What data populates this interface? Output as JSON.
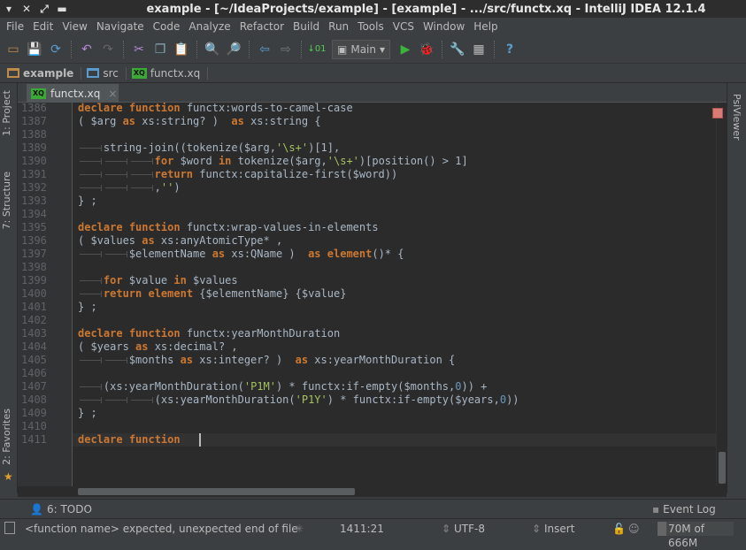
{
  "window": {
    "title": "example - [~/IdeaProjects/example] - [example] - .../src/functx.xq - IntelliJ IDEA 12.1.4"
  },
  "menu": [
    "File",
    "Edit",
    "View",
    "Navigate",
    "Code",
    "Analyze",
    "Refactor",
    "Build",
    "Run",
    "Tools",
    "VCS",
    "Window",
    "Help"
  ],
  "toolbar": {
    "run_config": "Main"
  },
  "breadcrumbs": [
    "example",
    "src",
    "functx.xq"
  ],
  "tabs": [
    {
      "label": "functx.xq",
      "close": "×"
    }
  ],
  "left_tools": {
    "project": "1: Project",
    "structure": "7: Structure",
    "favorites": "2: Favorites"
  },
  "right_tools": {
    "psiviewer": "PsiViewer"
  },
  "editor": {
    "first_line": 1386,
    "current_line": 1411,
    "lines": [
      [
        [
          "k",
          "declare"
        ],
        [
          "t",
          " "
        ],
        [
          "k",
          "function"
        ],
        [
          "t",
          " functx:words-to-camel-case"
        ]
      ],
      [
        [
          "t",
          "( $arg "
        ],
        [
          "k",
          "as"
        ],
        [
          "t",
          " xs:string? )  "
        ],
        [
          "k",
          "as"
        ],
        [
          "t",
          " xs:string {"
        ]
      ],
      [],
      [
        [
          "tab",
          ""
        ],
        [
          "t",
          "string-join((tokenize($arg,"
        ],
        [
          "s",
          "'\\s+'"
        ],
        [
          "t",
          ")[1],"
        ]
      ],
      [
        [
          "tab",
          ""
        ],
        [
          "tab",
          ""
        ],
        [
          "tab",
          ""
        ],
        [
          "k",
          "for"
        ],
        [
          "t",
          " $word "
        ],
        [
          "k",
          "in"
        ],
        [
          "t",
          " tokenize($arg,"
        ],
        [
          "s",
          "'\\s+'"
        ],
        [
          "t",
          ")[position() > 1]"
        ]
      ],
      [
        [
          "tab",
          ""
        ],
        [
          "tab",
          ""
        ],
        [
          "tab",
          ""
        ],
        [
          "k",
          "return"
        ],
        [
          "t",
          " functx:capitalize-first($word))"
        ]
      ],
      [
        [
          "tab",
          ""
        ],
        [
          "tab",
          ""
        ],
        [
          "tab",
          ""
        ],
        [
          "t",
          ","
        ],
        [
          "s",
          "''"
        ],
        [
          "t",
          ")"
        ]
      ],
      [
        [
          "t",
          "} ;"
        ]
      ],
      [],
      [
        [
          "k",
          "declare"
        ],
        [
          "t",
          " "
        ],
        [
          "k",
          "function"
        ],
        [
          "t",
          " functx:wrap-values-in-elements"
        ]
      ],
      [
        [
          "t",
          "( $values "
        ],
        [
          "k",
          "as"
        ],
        [
          "t",
          " xs:anyAtomicType* ,"
        ]
      ],
      [
        [
          "tab",
          ""
        ],
        [
          "tab",
          ""
        ],
        [
          "t",
          "$elementName "
        ],
        [
          "k",
          "as"
        ],
        [
          "t",
          " xs:QName )  "
        ],
        [
          "k",
          "as"
        ],
        [
          "t",
          " "
        ],
        [
          "k",
          "element"
        ],
        [
          "t",
          "()* {"
        ]
      ],
      [],
      [
        [
          "tab",
          ""
        ],
        [
          "k",
          "for"
        ],
        [
          "t",
          " $value "
        ],
        [
          "k",
          "in"
        ],
        [
          "t",
          " $values"
        ]
      ],
      [
        [
          "tab",
          ""
        ],
        [
          "k",
          "return"
        ],
        [
          "t",
          " "
        ],
        [
          "k",
          "element"
        ],
        [
          "t",
          " {$elementName} {$value}"
        ]
      ],
      [
        [
          "t",
          "} ;"
        ]
      ],
      [],
      [
        [
          "k",
          "declare"
        ],
        [
          "t",
          " "
        ],
        [
          "k",
          "function"
        ],
        [
          "t",
          " functx:yearMonthDuration"
        ]
      ],
      [
        [
          "t",
          "( $years "
        ],
        [
          "k",
          "as"
        ],
        [
          "t",
          " xs:decimal? ,"
        ]
      ],
      [
        [
          "tab",
          ""
        ],
        [
          "tab",
          ""
        ],
        [
          "t",
          "$months "
        ],
        [
          "k",
          "as"
        ],
        [
          "t",
          " xs:integer? )  "
        ],
        [
          "k",
          "as"
        ],
        [
          "t",
          " xs:yearMonthDuration {"
        ]
      ],
      [],
      [
        [
          "tab",
          ""
        ],
        [
          "t",
          "(xs:yearMonthDuration("
        ],
        [
          "s",
          "'P1M'"
        ],
        [
          "t",
          ") * functx:if-empty($months,"
        ],
        [
          "n",
          "0"
        ],
        [
          "t",
          ")) +"
        ]
      ],
      [
        [
          "tab",
          ""
        ],
        [
          "tab",
          ""
        ],
        [
          "tab",
          ""
        ],
        [
          "t",
          "(xs:yearMonthDuration("
        ],
        [
          "s",
          "'P1Y'"
        ],
        [
          "t",
          ") * functx:if-empty($years,"
        ],
        [
          "n",
          "0"
        ],
        [
          "t",
          "))"
        ]
      ],
      [
        [
          "t",
          "} ;"
        ]
      ],
      [],
      [
        [
          "k",
          "declare"
        ],
        [
          "t",
          " "
        ],
        [
          "k",
          "function"
        ]
      ]
    ]
  },
  "tool_window_bar": {
    "todo": "6: TODO",
    "event_log": "Event Log"
  },
  "status": {
    "message": "<function name> expected, unexpected end of file",
    "position": "1411:21",
    "encoding": "UTF-8",
    "insert_mode": "Insert",
    "memory": "70M of 666M",
    "memory_used_fraction": 0.105
  },
  "colors": {
    "keyword": "#cc7832",
    "string": "#a5c261",
    "number": "#6897bb",
    "text": "#a9b7c6",
    "background": "#2b2b2b"
  }
}
